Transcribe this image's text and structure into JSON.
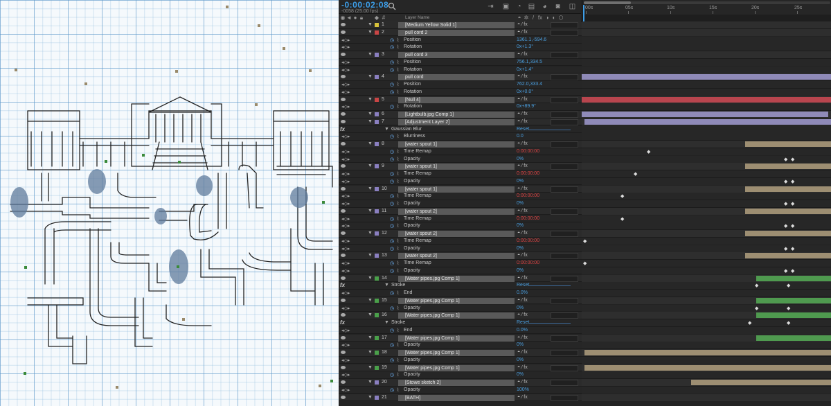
{
  "timeline": {
    "timecode": "-0:00:02:08",
    "frame_info": "-0058 (25.00 fps)",
    "header_layer_name": "Layer Name",
    "ruler": [
      "00s",
      "05s",
      "10s",
      "15s",
      "20s",
      "25s"
    ]
  },
  "layers": [
    {
      "kind": "layer",
      "num": "1",
      "name": "[Medium Yellow Solid 1]",
      "color": "#d8c33a"
    },
    {
      "kind": "layer",
      "num": "2",
      "name": "pull cord 2",
      "color": "#c94545"
    },
    {
      "kind": "prop",
      "name": "Position",
      "value": "1361.1,-594.6"
    },
    {
      "kind": "prop",
      "name": "Rotation",
      "value": "0x+1.3°"
    },
    {
      "kind": "layer",
      "num": "3",
      "name": "pull cord 3",
      "color": "#8a7fc0"
    },
    {
      "kind": "prop",
      "name": "Position",
      "value": "756.1,334.5"
    },
    {
      "kind": "prop",
      "name": "Rotation",
      "value": "0x+1.4°"
    },
    {
      "kind": "layer",
      "num": "4",
      "name": "pull cord",
      "color": "#8a7fc0"
    },
    {
      "kind": "prop",
      "name": "Position",
      "value": "762.0,333.4"
    },
    {
      "kind": "prop",
      "name": "Rotation",
      "value": "0x+0.0°"
    },
    {
      "kind": "layer",
      "num": "5",
      "name": "[Null 4]",
      "color": "#c94545"
    },
    {
      "kind": "prop",
      "name": "Rotation",
      "value": "0x+89.9°"
    },
    {
      "kind": "layer",
      "num": "6",
      "name": "[Lightbulb.jpg Comp 1]",
      "color": "#8a7fc0"
    },
    {
      "kind": "layer",
      "num": "7",
      "name": "[Adjustment Layer 2]",
      "color": "#8a7fc0"
    },
    {
      "kind": "effect",
      "name": "Gaussian Blur",
      "value": "Reset"
    },
    {
      "kind": "prop",
      "name": "Blurriness",
      "value": "0.0"
    },
    {
      "kind": "layer",
      "num": "8",
      "name": "[water spout 1]",
      "color": "#8a7fc0"
    },
    {
      "kind": "prop",
      "name": "Time Remap",
      "value": "0:00:00:00",
      "red": true
    },
    {
      "kind": "prop",
      "name": "Opacity",
      "value": "0%"
    },
    {
      "kind": "layer",
      "num": "9",
      "name": "[water spout 1]",
      "color": "#8a7fc0"
    },
    {
      "kind": "prop",
      "name": "Time Remap",
      "value": "0:00:00:00",
      "red": true
    },
    {
      "kind": "prop",
      "name": "Opacity",
      "value": "0%"
    },
    {
      "kind": "layer",
      "num": "10",
      "name": "[water spout 1]",
      "color": "#8a7fc0"
    },
    {
      "kind": "prop",
      "name": "Time Remap",
      "value": "0:00:00:00",
      "red": true
    },
    {
      "kind": "prop",
      "name": "Opacity",
      "value": "0%"
    },
    {
      "kind": "layer",
      "num": "11",
      "name": "[water spout 2]",
      "color": "#8a7fc0"
    },
    {
      "kind": "prop",
      "name": "Time Remap",
      "value": "0:00:00:00",
      "red": true
    },
    {
      "kind": "prop",
      "name": "Opacity",
      "value": "0%"
    },
    {
      "kind": "layer",
      "num": "12",
      "name": "[water spout 2]",
      "color": "#8a7fc0"
    },
    {
      "kind": "prop",
      "name": "Time Remap",
      "value": "0:00:00:00",
      "red": true
    },
    {
      "kind": "prop",
      "name": "Opacity",
      "value": "0%"
    },
    {
      "kind": "layer",
      "num": "13",
      "name": "[water spout 2]",
      "color": "#8a7fc0"
    },
    {
      "kind": "prop",
      "name": "Time Remap",
      "value": "0:00:00:00",
      "red": true
    },
    {
      "kind": "prop",
      "name": "Opacity",
      "value": "0%"
    },
    {
      "kind": "layer",
      "num": "14",
      "name": "[Water pipes.jpg Comp 1]",
      "color": "#4aa04a"
    },
    {
      "kind": "effect",
      "name": "Stroke",
      "value": "Reset"
    },
    {
      "kind": "prop",
      "name": "End",
      "value": "0.0%"
    },
    {
      "kind": "layer",
      "num": "15",
      "name": "[Water pipes.jpg Comp 1]",
      "color": "#4aa04a"
    },
    {
      "kind": "prop",
      "name": "Opacity",
      "value": "0%"
    },
    {
      "kind": "layer",
      "num": "16",
      "name": "[Water pipes.jpg Comp 1]",
      "color": "#4aa04a"
    },
    {
      "kind": "effect",
      "name": "Stroke",
      "value": "Reset"
    },
    {
      "kind": "prop",
      "name": "End",
      "value": "0.0%"
    },
    {
      "kind": "layer",
      "num": "17",
      "name": "[Water pipes.jpg Comp 1]",
      "color": "#4aa04a"
    },
    {
      "kind": "prop",
      "name": "Opacity",
      "value": "0%"
    },
    {
      "kind": "layer",
      "num": "18",
      "name": "[Water pipes.jpg Comp 1]",
      "color": "#4aa04a"
    },
    {
      "kind": "prop",
      "name": "Opacity",
      "value": "0%"
    },
    {
      "kind": "layer",
      "num": "19",
      "name": "[Water pipes.jpg Comp 1]",
      "color": "#4aa04a"
    },
    {
      "kind": "prop",
      "name": "Opacity",
      "value": "0%"
    },
    {
      "kind": "layer",
      "num": "20",
      "name": "[Stowe sketch 2]",
      "color": "#8a7fc0"
    },
    {
      "kind": "prop",
      "name": "Opacity",
      "value": "100%"
    },
    {
      "kind": "layer",
      "num": "21",
      "name": "[BATH]",
      "color": "#8a7fc0"
    }
  ],
  "colors": {
    "accent": "#3d9ee8",
    "value_blue": "#4a9fe0",
    "value_red": "#e04444",
    "purple_bar": "#8f8ab8",
    "red_bar": "#b8454e",
    "tan_bar": "#9d8e72",
    "green_bar": "#4f9a4f"
  }
}
